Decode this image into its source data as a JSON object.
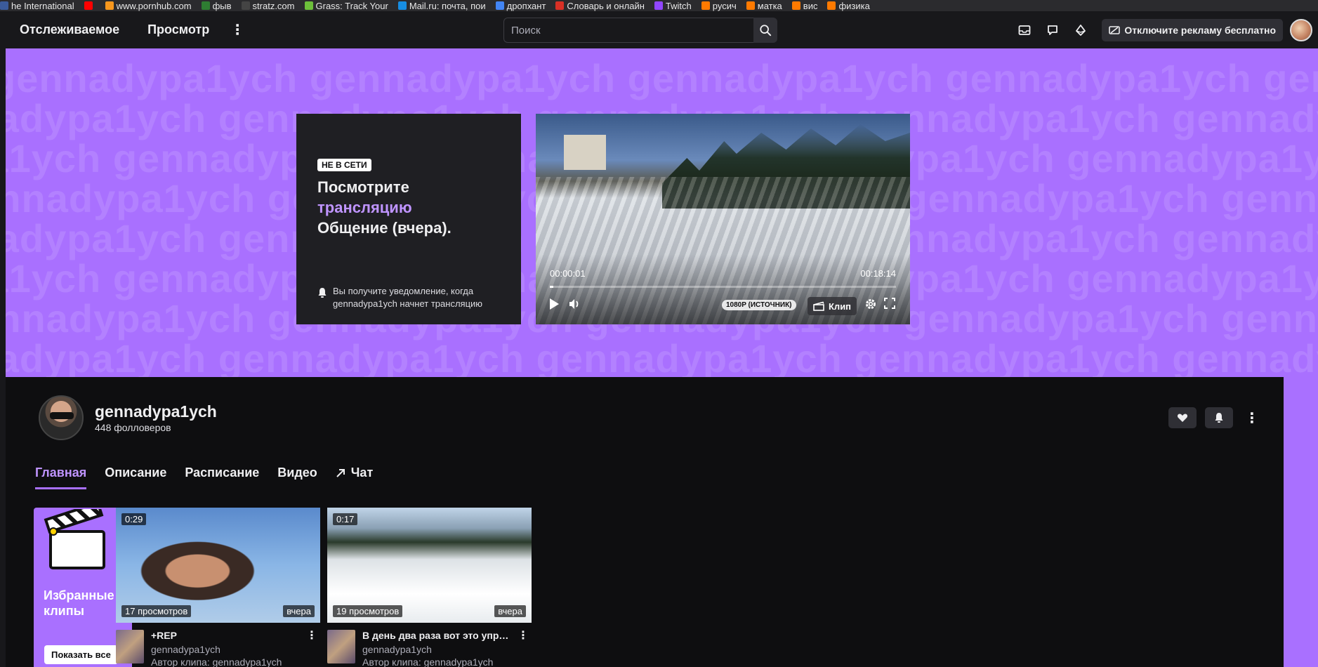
{
  "bookmarks": [
    {
      "label": "he International",
      "color": "#3b5b9a"
    },
    {
      "label": "",
      "color": "#ff0000"
    },
    {
      "label": "www.pornhub.com",
      "color": "#f7971d"
    },
    {
      "label": "фыв",
      "color": "#2e7d32"
    },
    {
      "label": "stratz.com",
      "color": "#444"
    },
    {
      "label": "Grass: Track Your",
      "color": "#6cbf3a"
    },
    {
      "label": "Mail.ru: почта, пои",
      "color": "#168de2"
    },
    {
      "label": "дропхант",
      "color": "#4285f4"
    },
    {
      "label": "Словарь и онлайн",
      "color": "#d93025"
    },
    {
      "label": "Twitch",
      "color": "#9146ff"
    },
    {
      "label": "русич",
      "color": "#ff7a00"
    },
    {
      "label": "матка",
      "color": "#ff7a00"
    },
    {
      "label": "вис",
      "color": "#ff7a00"
    },
    {
      "label": "физика",
      "color": "#ff7a00"
    }
  ],
  "topnav": {
    "following": "Отслеживаемое",
    "browse": "Просмотр",
    "more": "⋮",
    "search_placeholder": "Поиск",
    "ad_label": "Отключите рекламу бесплатно"
  },
  "banner": {
    "watermark_text": "gennadypa1ych",
    "offline_badge": "НЕ В СЕТИ",
    "title_line1": "Посмотрите",
    "title_accent": "трансляцию",
    "title_line3": "Общение (вчера).",
    "notify_text": "Вы получите уведомление, когда gennadypa1ych начнет трансляцию"
  },
  "video": {
    "time_current": "00:00:01",
    "time_total": "00:18:14",
    "progress": 0.002,
    "quality": "1080P (ИСТОЧНИК)",
    "clip_label": "Клип"
  },
  "channel": {
    "name": "gennadypa1ych",
    "followers": "448 фолловеров",
    "tabs": [
      "Главная",
      "Описание",
      "Расписание",
      "Видео",
      "Чат"
    ],
    "active_tab": 0
  },
  "featured": {
    "title": "Избранные клипы",
    "button": "Показать все"
  },
  "clips": [
    {
      "duration": "0:29",
      "views": "17 просмотров",
      "age": "вчера",
      "title": "+REP",
      "channel": "gennadypa1ych",
      "author": "Автор клипа: gennadypa1ych"
    },
    {
      "duration": "0:17",
      "views": "19 просмотров",
      "age": "вчера",
      "title": "В день два раза вот это упра...",
      "channel": "gennadypa1ych",
      "author": "Автор клипа: gennadypa1ych"
    }
  ],
  "colors": {
    "accent": "#a970ff",
    "accent_text": "#bf94ff",
    "bg": "#0e0e10",
    "surface": "#18181b"
  }
}
